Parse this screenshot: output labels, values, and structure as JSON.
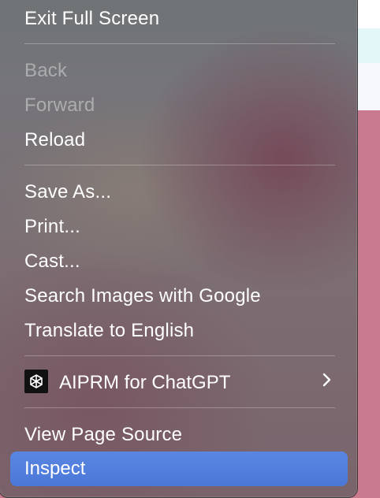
{
  "context_menu": {
    "groups": [
      {
        "items": [
          {
            "label": "Exit Full Screen",
            "enabled": true
          }
        ]
      },
      {
        "items": [
          {
            "label": "Back",
            "enabled": false
          },
          {
            "label": "Forward",
            "enabled": false
          },
          {
            "label": "Reload",
            "enabled": true
          }
        ]
      },
      {
        "items": [
          {
            "label": "Save As...",
            "enabled": true
          },
          {
            "label": "Print...",
            "enabled": true
          },
          {
            "label": "Cast...",
            "enabled": true
          },
          {
            "label": "Search Images with Google",
            "enabled": true
          },
          {
            "label": "Translate to English",
            "enabled": true
          }
        ]
      },
      {
        "items": [
          {
            "label": "AIPRM for ChatGPT",
            "enabled": true,
            "has_submenu": true,
            "icon": "aiprm-logo-icon"
          }
        ]
      },
      {
        "items": [
          {
            "label": "View Page Source",
            "enabled": true
          },
          {
            "label": "Inspect",
            "enabled": true,
            "highlighted": true
          }
        ]
      }
    ],
    "submenu_indicator_icon": "chevron-right-icon",
    "highlight_color": "#4f7fdf"
  }
}
